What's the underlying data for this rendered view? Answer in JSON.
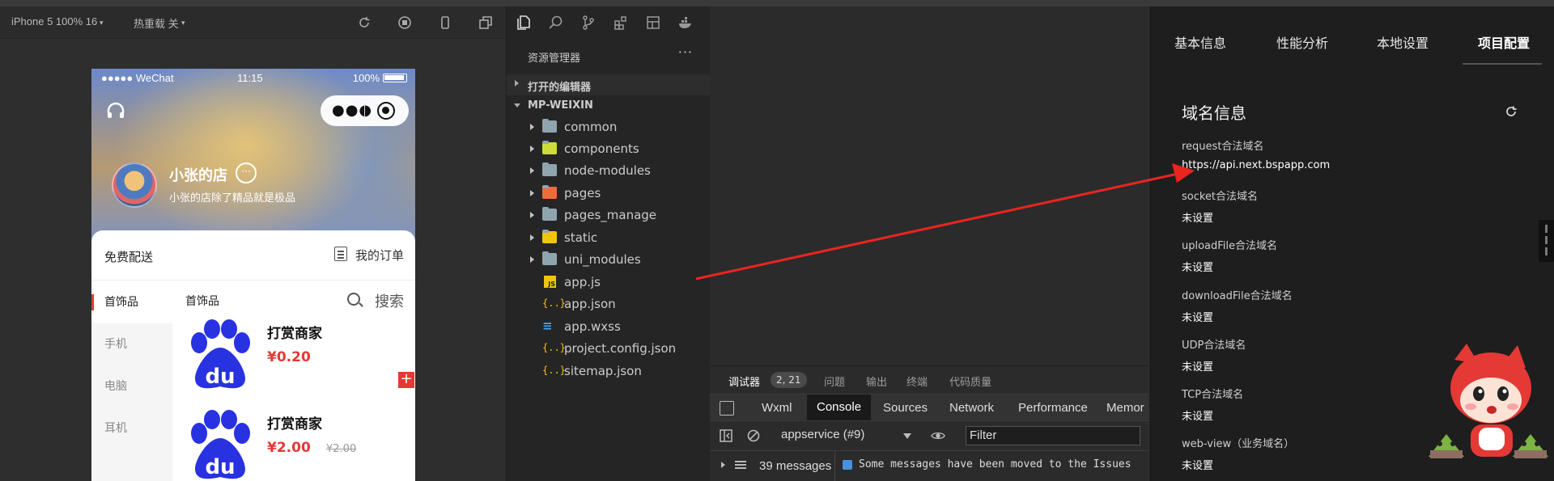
{
  "simulator": {
    "device": "iPhone 5 100% 16",
    "hot_reload": "热重载 关",
    "status": {
      "carrier": "●●●●● WeChat",
      "time": "11:15",
      "battery": "100%"
    },
    "shop": {
      "name": "小张的店",
      "desc": "小张的店除了精品就是极品",
      "more": "···"
    },
    "delivery": "免费配送",
    "my_orders": "我的订单",
    "categories": [
      "首饰品",
      "手机",
      "电脑",
      "耳机"
    ],
    "active_category_title": "首饰品",
    "search_label": "搜索",
    "items": [
      {
        "name": "打赏商家",
        "price": "¥0.20",
        "old_price": ""
      },
      {
        "name": "打赏商家",
        "price": "¥2.00",
        "old_price": "¥2.00"
      }
    ],
    "add_symbol": "+",
    "logo_text": "du"
  },
  "explorer": {
    "header": "资源管理器",
    "more": "···",
    "open_editors": "打开的编辑器",
    "project": "MP-WEIXIN",
    "files": [
      {
        "label": "common",
        "kind": "folder"
      },
      {
        "label": "components",
        "kind": "folder"
      },
      {
        "label": "node-modules",
        "kind": "folder"
      },
      {
        "label": "pages",
        "kind": "folder"
      },
      {
        "label": "pages_manage",
        "kind": "folder"
      },
      {
        "label": "static",
        "kind": "folder"
      },
      {
        "label": "uni_modules",
        "kind": "folder"
      },
      {
        "label": "app.js",
        "kind": "js"
      },
      {
        "label": "app.json",
        "kind": "json"
      },
      {
        "label": "app.wxss",
        "kind": "wxss"
      },
      {
        "label": "project.config.json",
        "kind": "json"
      },
      {
        "label": "sitemap.json",
        "kind": "json"
      }
    ]
  },
  "devtools": {
    "top_tabs": [
      "调试器",
      "问题",
      "输出",
      "终端",
      "代码质量"
    ],
    "badge": "2, 21",
    "tabs": [
      "Wxml",
      "Console",
      "Sources",
      "Network",
      "Performance",
      "Memor"
    ],
    "active_tab": "Console",
    "context": "appservice (#9)",
    "filter_placeholder": "Filter",
    "messages_count": "39 messages",
    "message": "Some messages have been moved to the Issues"
  },
  "details": {
    "tabs": [
      "基本信息",
      "性能分析",
      "本地设置",
      "项目配置"
    ],
    "active_tab": "项目配置",
    "section_title": "域名信息",
    "domains": [
      {
        "key": "request合法域名",
        "value": "https://api.next.bspapp.com"
      },
      {
        "key": "socket合法域名",
        "value": "未设置"
      },
      {
        "key": "uploadFile合法域名",
        "value": "未设置"
      },
      {
        "key": "downloadFile合法域名",
        "value": "未设置"
      },
      {
        "key": "UDP合法域名",
        "value": "未设置"
      },
      {
        "key": "TCP合法域名",
        "value": "未设置"
      },
      {
        "key": "web-view（业务域名）",
        "value": "未设置"
      }
    ]
  },
  "colors": {
    "accent_red": "#e53935",
    "annotation_arrow": "#e8251f",
    "panel_bg": "#1e1e1e"
  }
}
